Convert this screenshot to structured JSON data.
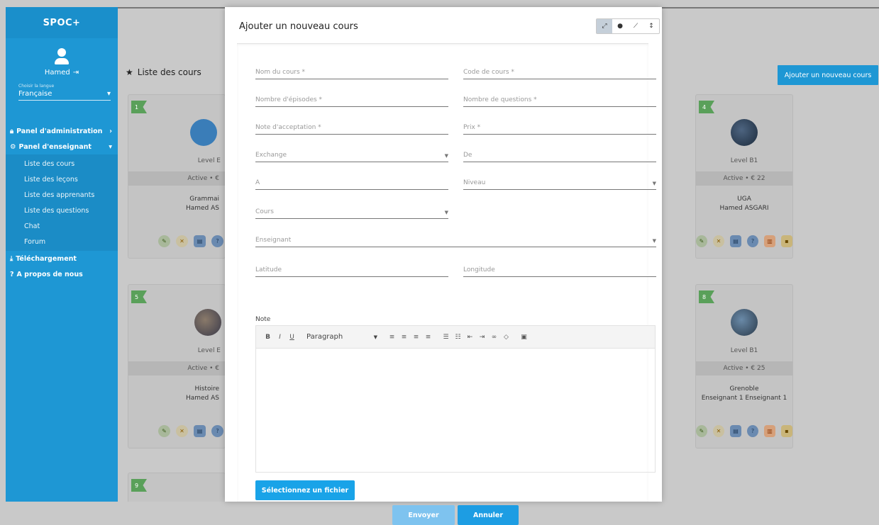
{
  "sidebar": {
    "brand": "SPOC+",
    "user_name": "Hamed",
    "language_label": "Choisir la langue",
    "language_value": "Française",
    "menu": {
      "admin_panel": "Panel d'administration",
      "teacher_panel": "Panel d'enseignant",
      "sub_items": [
        "Liste des cours",
        "Liste des leçons",
        "Liste des apprenants",
        "Liste des questions",
        "Chat",
        "Forum"
      ],
      "download": "Téléchargement",
      "about": "A propos de nous"
    }
  },
  "main": {
    "page_title": "Liste des cours",
    "add_course_button": "Ajouter un nouveau cours",
    "cards": [
      {
        "flag": "1",
        "level": "Level E",
        "status": "Active • €",
        "line1": "Grammai",
        "line2": "Hamed AS"
      },
      {
        "flag": "4",
        "level": "Level B1",
        "status": "Active • € 22",
        "line1": "UGA",
        "line2": "Hamed ASGARI"
      },
      {
        "flag": "5",
        "level": "Level E",
        "status": "Active • €",
        "line1": "Histoire",
        "line2": "Hamed AS"
      },
      {
        "flag": "8",
        "level": "Level B1",
        "status": "Active • € 25",
        "line1": "Grenoble",
        "line2": "Enseignant 1 Enseignant 1"
      },
      {
        "flag": "9"
      }
    ]
  },
  "modal": {
    "title": "Ajouter un nouveau cours",
    "fields": {
      "course_name": "Nom du cours *",
      "course_code": "Code de cours *",
      "episodes": "Nombre d'épisodes *",
      "questions": "Nombre de questions *",
      "acceptance": "Note d'acceptation *",
      "price": "Prix *",
      "exchange": "Exchange",
      "from": "De",
      "to": "A",
      "level": "Niveau",
      "course": "Cours",
      "teacher": "Enseignant",
      "latitude": "Latitude",
      "longitude": "Longitude"
    },
    "note_label": "Note",
    "editor": {
      "bold": "B",
      "italic": "I",
      "underline": "U",
      "format": "Paragraph"
    },
    "file_button": "Sélectionnez un fichier",
    "submit_button": "Envoyer",
    "cancel_button": "Annuler"
  },
  "colors": {
    "primary": "#1e97d4",
    "overlay": "#c9c9c9"
  }
}
